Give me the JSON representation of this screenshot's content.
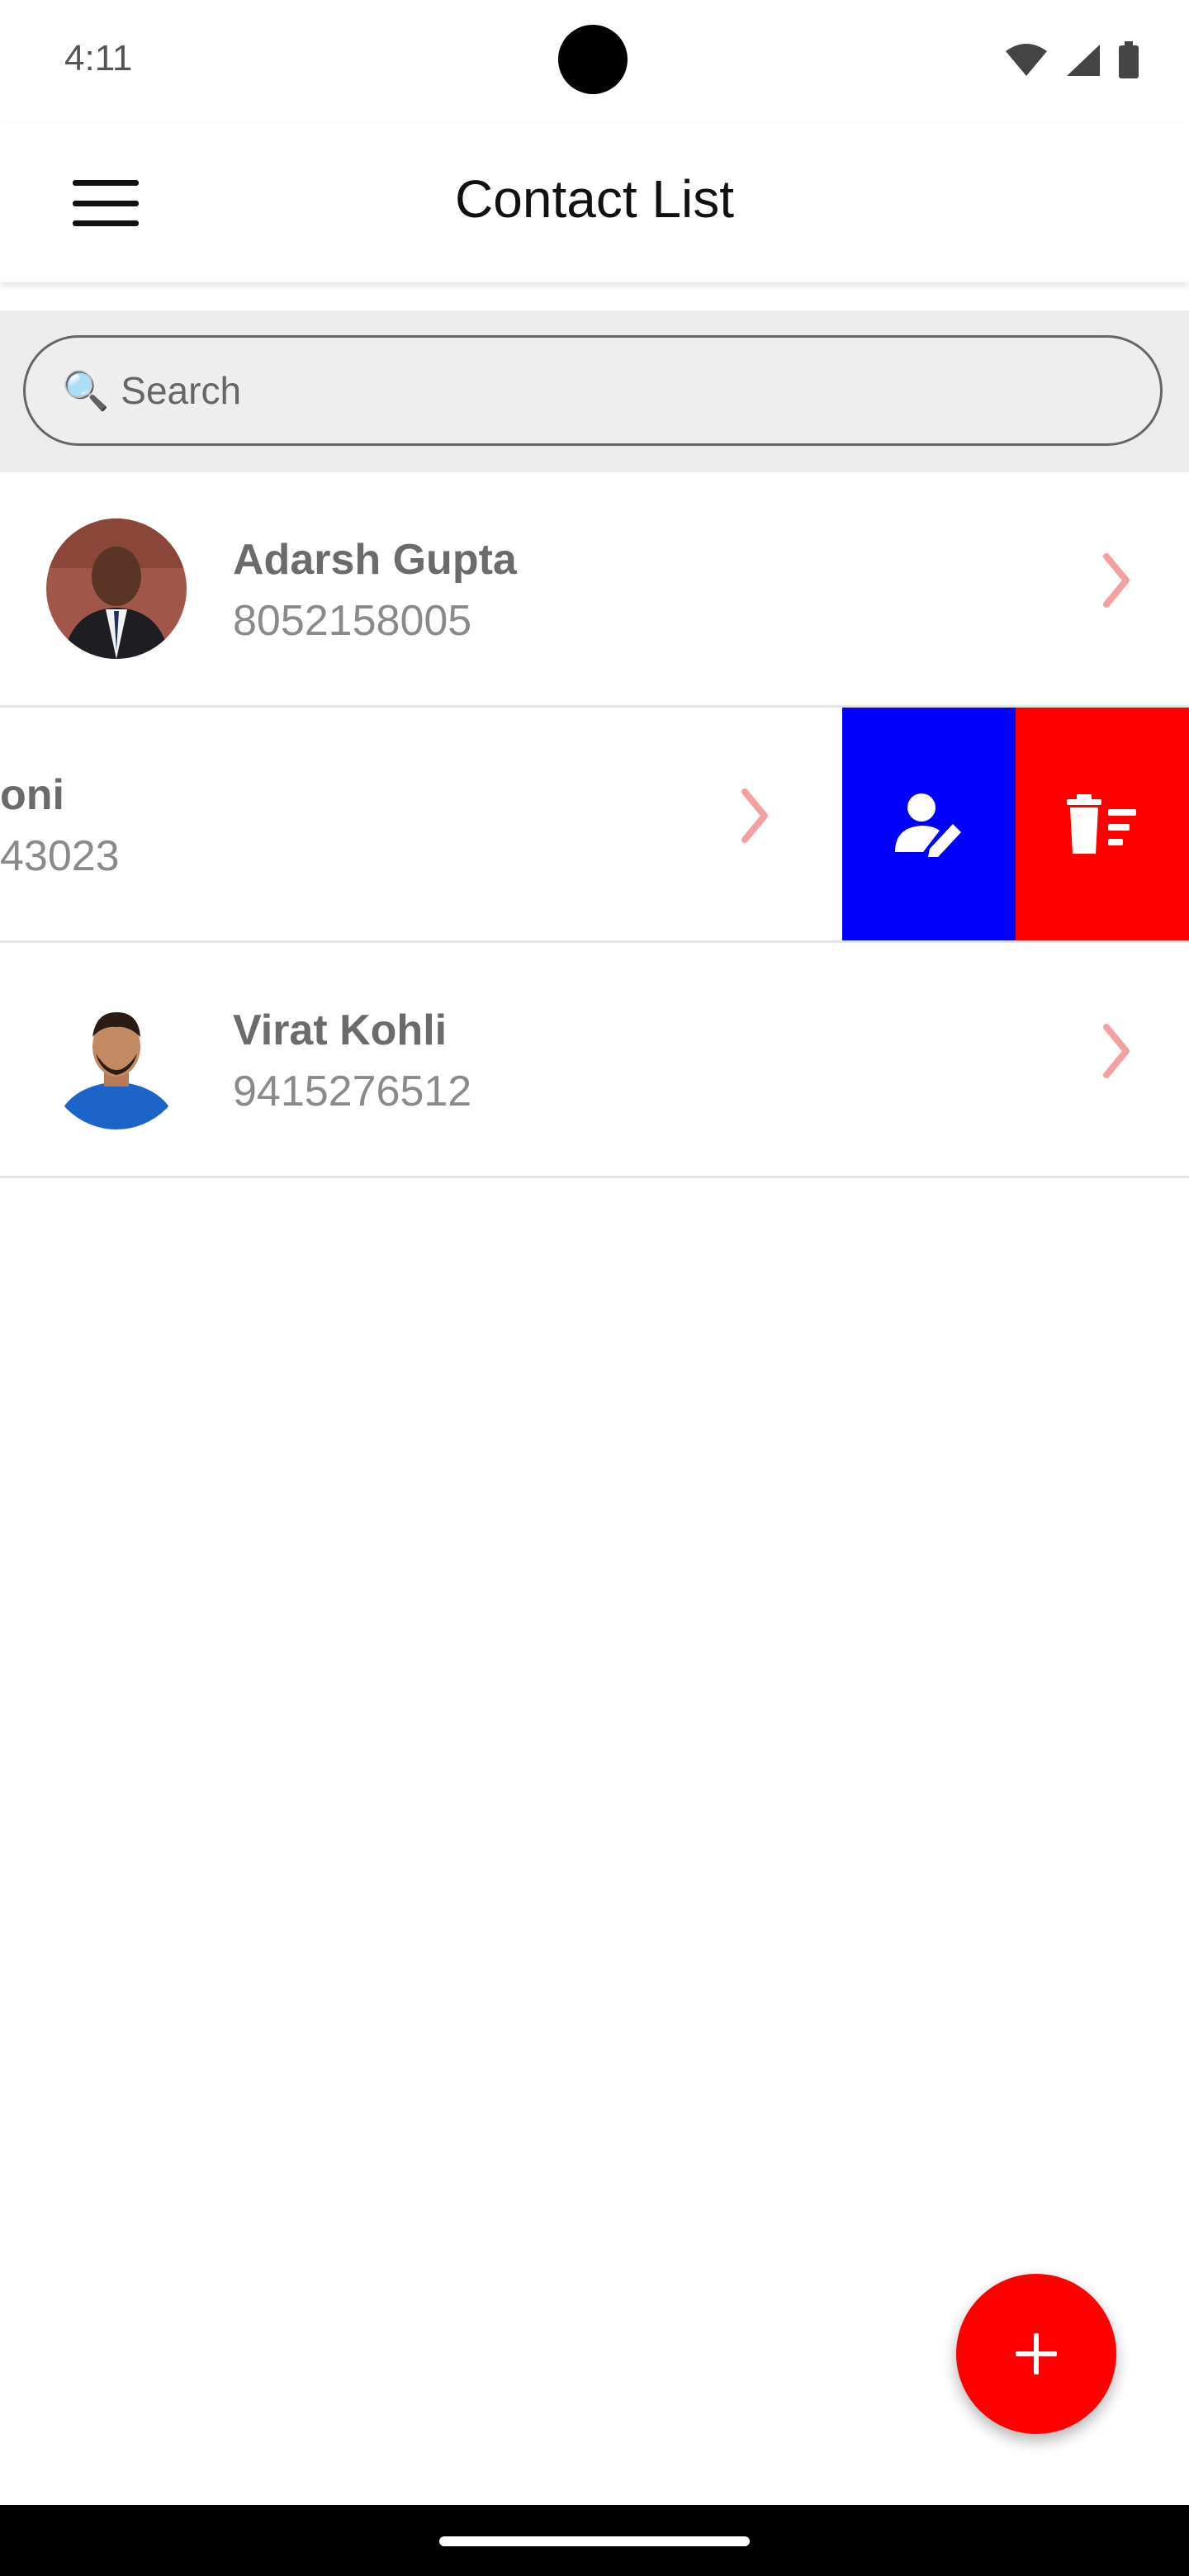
{
  "status_bar": {
    "time": "4:11"
  },
  "app_bar": {
    "title": "Contact List"
  },
  "search": {
    "placeholder": "Search",
    "value": ""
  },
  "contacts": [
    {
      "name": "Adarsh Gupta",
      "phone": "8052158005"
    },
    {
      "name": "oni",
      "phone": "43023",
      "swiped": true
    },
    {
      "name": "Virat Kohli",
      "phone": "9415276512"
    }
  ],
  "colors": {
    "edit_action": "#0000ff",
    "delete_action": "#ff0000",
    "fab": "#ff0000",
    "chevron": "#f4a0a0"
  },
  "icons": [
    "menu-icon",
    "search-icon",
    "chevron-right-icon",
    "user-edit-icon",
    "delete-list-icon",
    "plus-icon"
  ]
}
